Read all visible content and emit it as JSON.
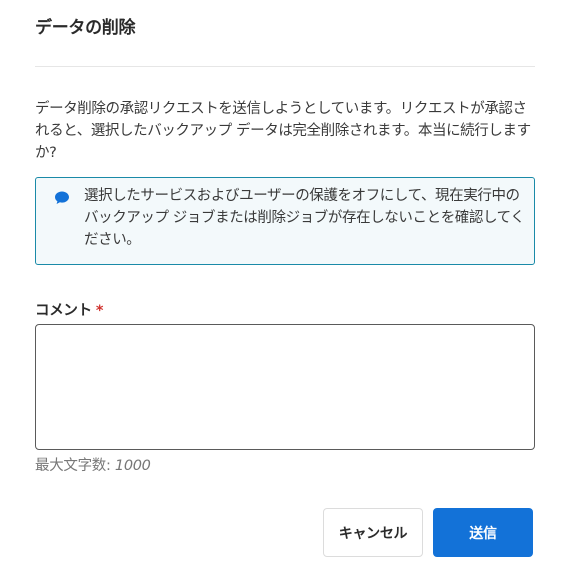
{
  "dialog": {
    "title": "データの削除",
    "message": "データ削除の承認リクエストを送信しようとしています。リクエストが承認されると、選択したバックアップ データは完全削除されます。本当に続行しますか?",
    "info": {
      "icon": "chat-bubble-icon",
      "icon_color": "#1372d8",
      "text": "選択したサービスおよびユーザーの保護をオフにして、現在実行中のバックアップ ジョブまたは削除ジョブが存在しないことを確認してください。"
    },
    "comment": {
      "label": "コメント",
      "required_mark": "*",
      "value": "",
      "max_label": "最大文字数:",
      "max_value": "1000"
    },
    "buttons": {
      "cancel": "キャンセル",
      "submit": "送信"
    },
    "colors": {
      "accent": "#1372d8",
      "info_border": "#1a8aa8",
      "info_bg": "#f3f9fb",
      "required": "#d0312d"
    }
  }
}
